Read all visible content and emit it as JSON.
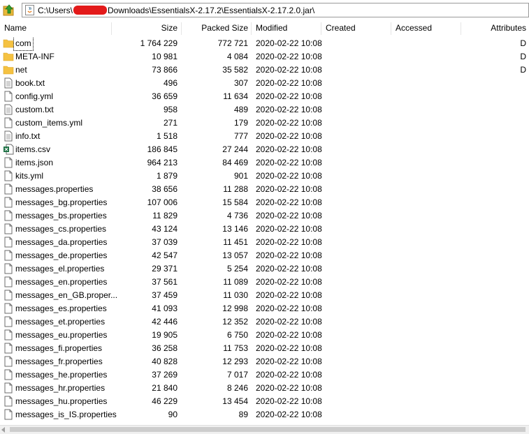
{
  "address": {
    "prefix": "C:\\Users\\",
    "suffix": "Downloads\\EssentialsX-2.17.2\\EssentialsX-2.17.2.0.jar\\"
  },
  "columns": {
    "name": "Name",
    "size": "Size",
    "packed": "Packed Size",
    "modified": "Modified",
    "created": "Created",
    "accessed": "Accessed",
    "attributes": "Attributes"
  },
  "icons": {
    "up": "folder-up-icon",
    "address": "java-archive-icon",
    "folder": "folder-icon",
    "text": "text-file-icon",
    "blank": "blank-file-icon",
    "csv": "excel-csv-icon"
  },
  "colors": {
    "folder": "#f5c242",
    "redaction": "#e31a1a"
  },
  "files": [
    {
      "name": "com",
      "size": "1 764 229",
      "packed": "772 721",
      "modified": "2020-02-22 10:08",
      "attributes": "D",
      "icon": "folder",
      "selected": true
    },
    {
      "name": "META-INF",
      "size": "10 981",
      "packed": "4 084",
      "modified": "2020-02-22 10:08",
      "attributes": "D",
      "icon": "folder"
    },
    {
      "name": "net",
      "size": "73 866",
      "packed": "35 582",
      "modified": "2020-02-22 10:08",
      "attributes": "D",
      "icon": "folder"
    },
    {
      "name": "book.txt",
      "size": "496",
      "packed": "307",
      "modified": "2020-02-22 10:08",
      "attributes": "",
      "icon": "text"
    },
    {
      "name": "config.yml",
      "size": "36 659",
      "packed": "11 634",
      "modified": "2020-02-22 10:08",
      "attributes": "",
      "icon": "blank"
    },
    {
      "name": "custom.txt",
      "size": "958",
      "packed": "489",
      "modified": "2020-02-22 10:08",
      "attributes": "",
      "icon": "text"
    },
    {
      "name": "custom_items.yml",
      "size": "271",
      "packed": "179",
      "modified": "2020-02-22 10:08",
      "attributes": "",
      "icon": "blank"
    },
    {
      "name": "info.txt",
      "size": "1 518",
      "packed": "777",
      "modified": "2020-02-22 10:08",
      "attributes": "",
      "icon": "text"
    },
    {
      "name": "items.csv",
      "size": "186 845",
      "packed": "27 244",
      "modified": "2020-02-22 10:08",
      "attributes": "",
      "icon": "csv"
    },
    {
      "name": "items.json",
      "size": "964 213",
      "packed": "84 469",
      "modified": "2020-02-22 10:08",
      "attributes": "",
      "icon": "blank"
    },
    {
      "name": "kits.yml",
      "size": "1 879",
      "packed": "901",
      "modified": "2020-02-22 10:08",
      "attributes": "",
      "icon": "blank"
    },
    {
      "name": "messages.properties",
      "size": "38 656",
      "packed": "11 288",
      "modified": "2020-02-22 10:08",
      "attributes": "",
      "icon": "blank"
    },
    {
      "name": "messages_bg.properties",
      "size": "107 006",
      "packed": "15 584",
      "modified": "2020-02-22 10:08",
      "attributes": "",
      "icon": "blank"
    },
    {
      "name": "messages_bs.properties",
      "size": "11 829",
      "packed": "4 736",
      "modified": "2020-02-22 10:08",
      "attributes": "",
      "icon": "blank"
    },
    {
      "name": "messages_cs.properties",
      "size": "43 124",
      "packed": "13 146",
      "modified": "2020-02-22 10:08",
      "attributes": "",
      "icon": "blank"
    },
    {
      "name": "messages_da.properties",
      "size": "37 039",
      "packed": "11 451",
      "modified": "2020-02-22 10:08",
      "attributes": "",
      "icon": "blank"
    },
    {
      "name": "messages_de.properties",
      "size": "42 547",
      "packed": "13 057",
      "modified": "2020-02-22 10:08",
      "attributes": "",
      "icon": "blank"
    },
    {
      "name": "messages_el.properties",
      "size": "29 371",
      "packed": "5 254",
      "modified": "2020-02-22 10:08",
      "attributes": "",
      "icon": "blank"
    },
    {
      "name": "messages_en.properties",
      "size": "37 561",
      "packed": "11 089",
      "modified": "2020-02-22 10:08",
      "attributes": "",
      "icon": "blank"
    },
    {
      "name": "messages_en_GB.proper...",
      "size": "37 459",
      "packed": "11 030",
      "modified": "2020-02-22 10:08",
      "attributes": "",
      "icon": "blank"
    },
    {
      "name": "messages_es.properties",
      "size": "41 093",
      "packed": "12 998",
      "modified": "2020-02-22 10:08",
      "attributes": "",
      "icon": "blank"
    },
    {
      "name": "messages_et.properties",
      "size": "42 446",
      "packed": "12 352",
      "modified": "2020-02-22 10:08",
      "attributes": "",
      "icon": "blank"
    },
    {
      "name": "messages_eu.properties",
      "size": "19 905",
      "packed": "6 750",
      "modified": "2020-02-22 10:08",
      "attributes": "",
      "icon": "blank"
    },
    {
      "name": "messages_fi.properties",
      "size": "36 258",
      "packed": "11 753",
      "modified": "2020-02-22 10:08",
      "attributes": "",
      "icon": "blank"
    },
    {
      "name": "messages_fr.properties",
      "size": "40 828",
      "packed": "12 293",
      "modified": "2020-02-22 10:08",
      "attributes": "",
      "icon": "blank"
    },
    {
      "name": "messages_he.properties",
      "size": "37 269",
      "packed": "7 017",
      "modified": "2020-02-22 10:08",
      "attributes": "",
      "icon": "blank"
    },
    {
      "name": "messages_hr.properties",
      "size": "21 840",
      "packed": "8 246",
      "modified": "2020-02-22 10:08",
      "attributes": "",
      "icon": "blank"
    },
    {
      "name": "messages_hu.properties",
      "size": "46 229",
      "packed": "13 454",
      "modified": "2020-02-22 10:08",
      "attributes": "",
      "icon": "blank"
    },
    {
      "name": "messages_is_IS.properties",
      "size": "90",
      "packed": "89",
      "modified": "2020-02-22 10:08",
      "attributes": "",
      "icon": "blank"
    }
  ]
}
